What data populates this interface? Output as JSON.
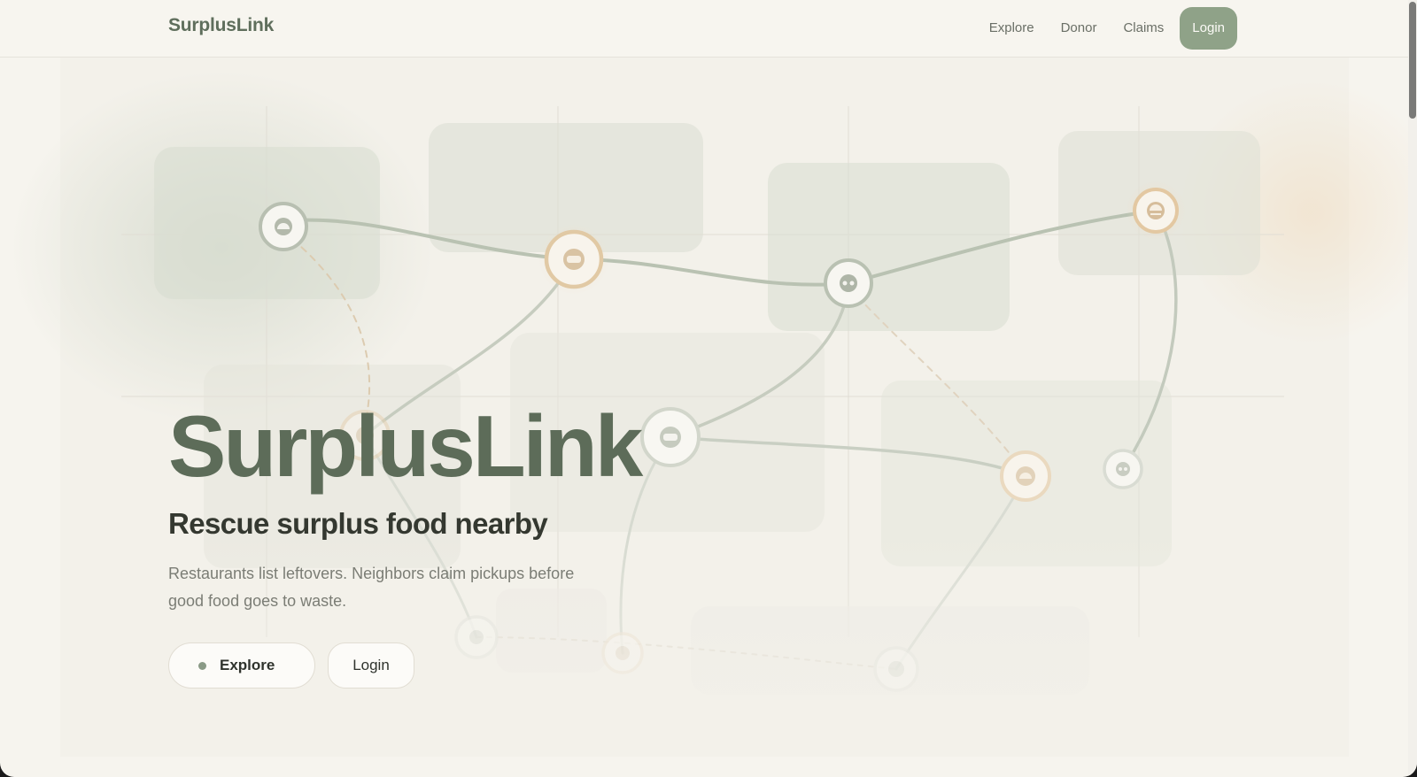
{
  "header": {
    "brand": "SurplusLink",
    "nav": [
      {
        "label": "Explore"
      },
      {
        "label": "Donor"
      },
      {
        "label": "Claims"
      }
    ],
    "login_label": "Login"
  },
  "hero": {
    "title": "SurplusLink",
    "subtitle": "Rescue surplus food nearby",
    "body": "Restaurants list leftovers. Neighbors claim pickups before good food goes to waste.",
    "explore_label": "Explore",
    "login_label": "Login"
  },
  "theme": {
    "accent": "#8fa288",
    "brand_text": "#5d6c59",
    "warm_node": "#e2c7a0",
    "background": "#f6f4ee"
  }
}
